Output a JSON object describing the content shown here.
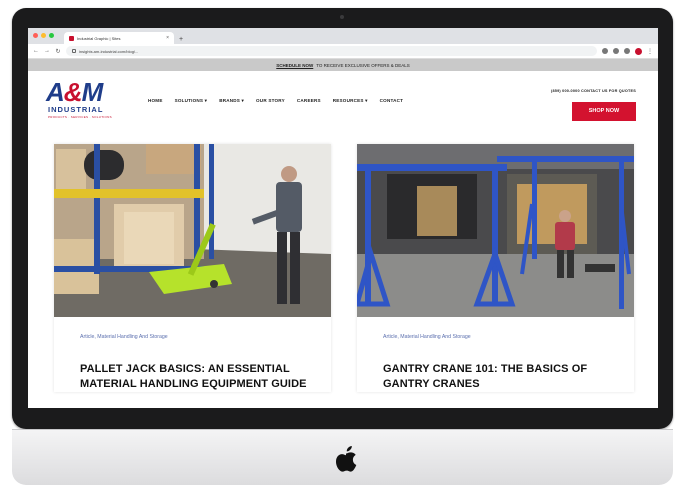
{
  "browser": {
    "tab_title": "Industrial Graphic | Sites",
    "url": "insights.am-industrial.com/blog/..."
  },
  "site": {
    "promo_link": "SCHEDULE NOW",
    "promo_text": "TO RECEIVE EXCLUSIVE OFFERS & DEALS",
    "logo_main": "A&M",
    "logo_sub": "INDUSTRIAL",
    "logo_tagline": "PRODUCTS · SERVICES · SOLUTIONS",
    "nav": [
      "HOME",
      "SOLUTIONS ▾",
      "BRANDS ▾",
      "OUR STORY",
      "CAREERS",
      "RESOURCES ▾",
      "CONTACT"
    ],
    "phone_line": "(859) 000-0000 CONTACT US FOR QUOTES",
    "shop_label": "SHOP NOW"
  },
  "articles": [
    {
      "category": "Article, Material Handling And Storage",
      "title": "PALLET JACK BASICS: AN ESSENTIAL MATERIAL HANDLING EQUIPMENT GUIDE"
    },
    {
      "category": "Article, Material Handling And Storage",
      "title": "GANTRY CRANE 101: THE BASICS OF GANTRY CRANES"
    }
  ],
  "colors": {
    "brand_blue": "#1f3d8a",
    "brand_red": "#d3122f",
    "category_blue": "#5b6fae"
  }
}
